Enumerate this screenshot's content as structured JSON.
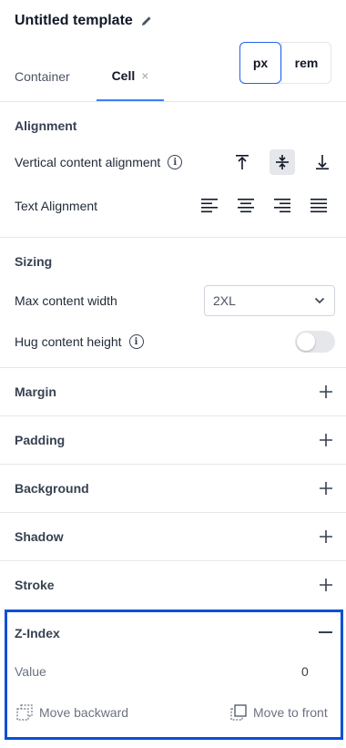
{
  "header": {
    "title": "Untitled template",
    "tabs": [
      {
        "label": "Container"
      },
      {
        "label": "Cell",
        "close": "×"
      }
    ],
    "units": {
      "px": "px",
      "rem": "rem",
      "selected": "px"
    }
  },
  "alignment": {
    "title": "Alignment",
    "vertical_label": "Vertical content alignment",
    "vertical_selected": "center",
    "text_label": "Text Alignment"
  },
  "sizing": {
    "title": "Sizing",
    "max_width_label": "Max content width",
    "max_width_value": "2XL",
    "hug_label": "Hug content height",
    "hug_enabled": false
  },
  "collapsed_sections": [
    {
      "title": "Margin"
    },
    {
      "title": "Padding"
    },
    {
      "title": "Background"
    },
    {
      "title": "Shadow"
    },
    {
      "title": "Stroke"
    }
  ],
  "zindex": {
    "title": "Z-Index",
    "value_label": "Value",
    "value": "0",
    "move_backward": "Move backward",
    "move_front": "Move to front",
    "highlight_color": "#0a4fd6"
  },
  "colors": {
    "accent": "#2563eb",
    "divider": "#e5e7eb"
  }
}
